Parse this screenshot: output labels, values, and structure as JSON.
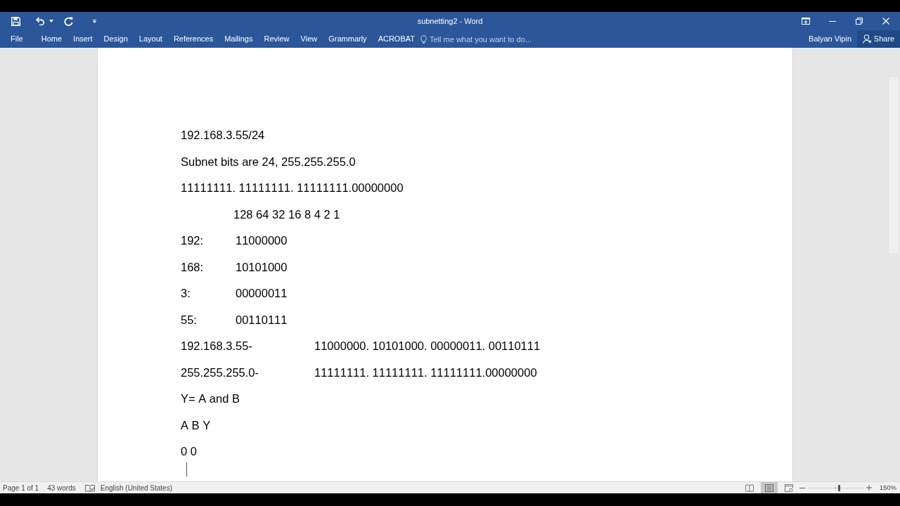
{
  "window": {
    "title": "subnetting2 - Word"
  },
  "ribbon": {
    "tabs": [
      {
        "label": "File",
        "selected": false
      },
      {
        "label": "Home",
        "selected": false
      },
      {
        "label": "Insert",
        "selected": false
      },
      {
        "label": "Design",
        "selected": false
      },
      {
        "label": "Layout",
        "selected": false
      },
      {
        "label": "References",
        "selected": false
      },
      {
        "label": "Mailings",
        "selected": false
      },
      {
        "label": "Review",
        "selected": false
      },
      {
        "label": "View",
        "selected": false
      },
      {
        "label": "Grammarly",
        "selected": false
      },
      {
        "label": "ACROBAT",
        "selected": false
      }
    ],
    "tell_me": {
      "placeholder": "Tell me what you want to do..."
    },
    "user": "Balyan Vipin",
    "share": "Share"
  },
  "document": {
    "paragraphs": [
      {
        "kind": "plain",
        "text": "192.168.3.55/24"
      },
      {
        "kind": "plain",
        "text": "Subnet bits are 24, 255.255.255.0"
      },
      {
        "kind": "plain",
        "text": "11111111. 11111111. 11111111.00000000"
      },
      {
        "kind": "indented",
        "text": "128 64 32 16 8 4 2 1"
      },
      {
        "kind": "pair",
        "label": "192:",
        "value": "11000000"
      },
      {
        "kind": "pair",
        "label": "168:",
        "value": "10101000"
      },
      {
        "kind": "pair",
        "label": "3:",
        "value": "00000011"
      },
      {
        "kind": "pair",
        "label": "55:",
        "value": "00110111"
      },
      {
        "kind": "widepair",
        "label": "192.168.3.55-",
        "value": "11000000. 10101000. 00000011. 00110111"
      },
      {
        "kind": "widepair",
        "label": "255.255.255.0-",
        "value": "11111111. 11111111. 11111111.00000000"
      },
      {
        "kind": "plain",
        "text": "Y= A and B"
      },
      {
        "kind": "plain",
        "text": "A B Y"
      },
      {
        "kind": "plain",
        "text": "0 0"
      }
    ]
  },
  "status_bar": {
    "page": "Page 1 of 1",
    "words": "43 words",
    "language": "English (United States)",
    "views": [
      {
        "kind": "read",
        "selected": false
      },
      {
        "kind": "print",
        "selected": true
      },
      {
        "kind": "web",
        "selected": false
      }
    ],
    "zoom": {
      "level": 0.56,
      "reading": "150%"
    }
  }
}
